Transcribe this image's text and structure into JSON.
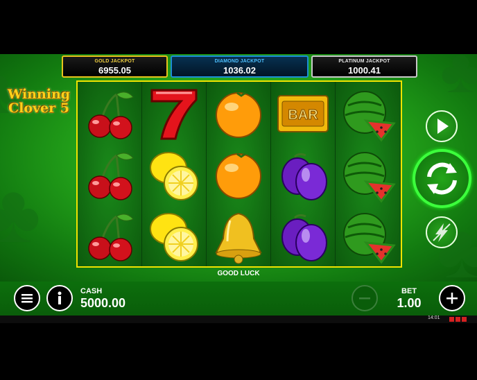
{
  "jackpots": [
    {
      "label": "GOLD JACKPOT",
      "value": "6955.05"
    },
    {
      "label": "DIAMOND JACKPOT",
      "value": "1036.02"
    },
    {
      "label": "PLATINUM JACKPOT",
      "value": "1000.41"
    }
  ],
  "logo": {
    "line1": "Winning",
    "line2": "Clover 5"
  },
  "reels": [
    [
      "cherry",
      "cherry",
      "cherry"
    ],
    [
      "seven",
      "lemon",
      "lemon"
    ],
    [
      "orange",
      "orange",
      "bell"
    ],
    [
      "bar",
      "plum",
      "plum"
    ],
    [
      "watermelon",
      "watermelon",
      "watermelon"
    ]
  ],
  "bar_symbol_text": "BAR",
  "message": "GOOD LUCK",
  "controls": {
    "play_icon": "play-icon",
    "spin_icon": "spin-arrows-icon",
    "turbo_icon": "turbo-lightning-icon",
    "menu_icon": "menu-icon",
    "info_icon": "info-icon",
    "minus_icon": "minus-icon",
    "plus_icon": "plus-icon"
  },
  "cash": {
    "label": "CASH",
    "value": "5000.00"
  },
  "bet": {
    "label": "BET",
    "value": "1.00"
  },
  "status": {
    "time": "14:01"
  },
  "colors": {
    "accent_green": "#3cff3c",
    "gold": "#e9c31c",
    "diamond": "#1b8fd6",
    "platinum": "#c9c9c9",
    "reel_border": "#f1e300"
  }
}
